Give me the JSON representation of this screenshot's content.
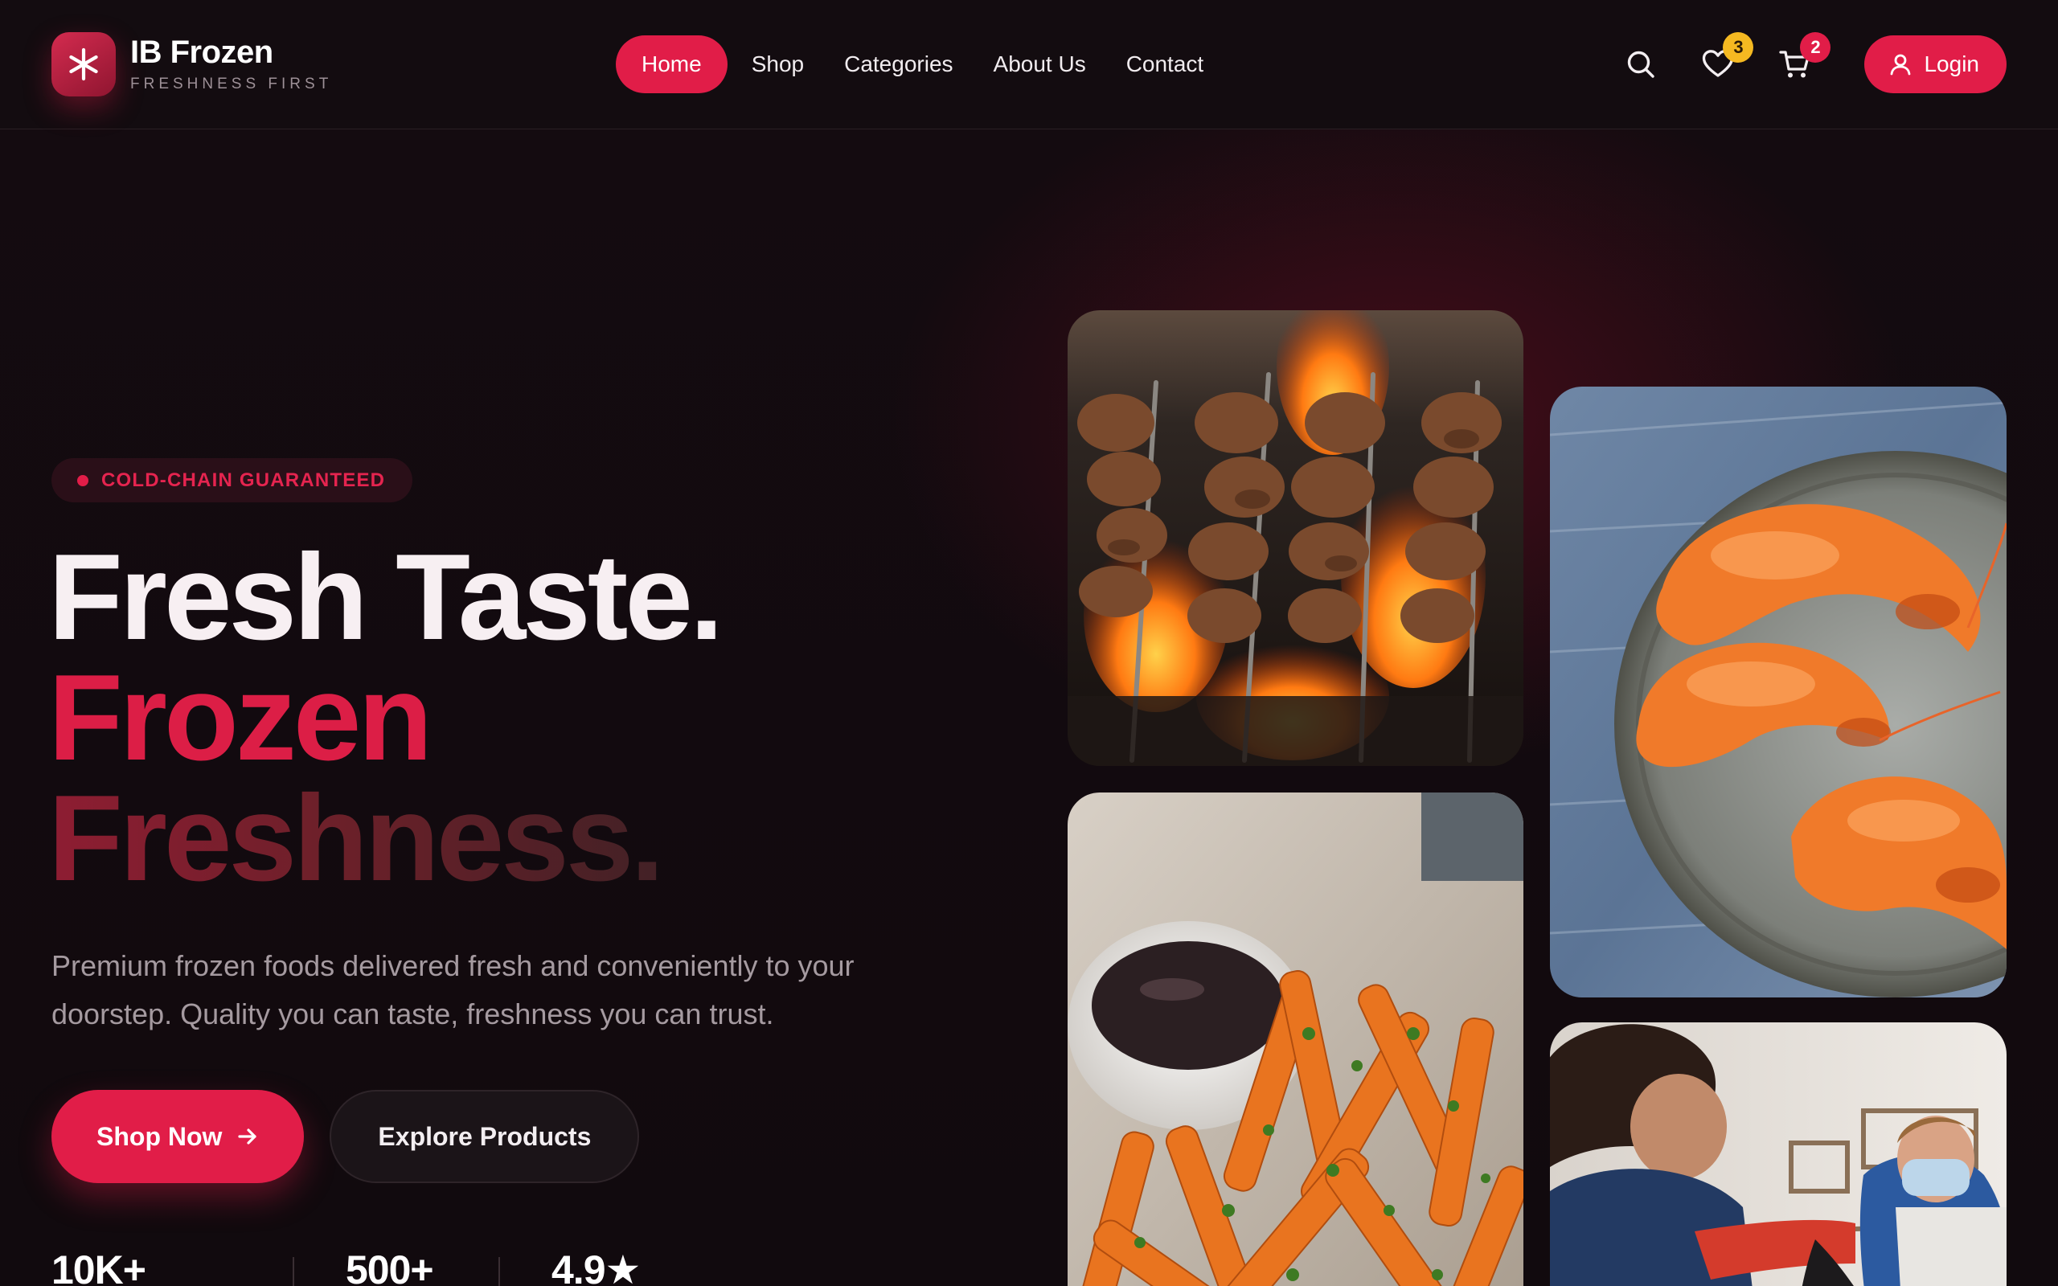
{
  "brand": {
    "name": "IB Frozen",
    "tagline": "FRESHNESS FIRST",
    "logo_icon": "snowflake-icon",
    "accent_color": "#e11d48"
  },
  "nav": {
    "items": [
      {
        "label": "Home",
        "active": true
      },
      {
        "label": "Shop",
        "active": false
      },
      {
        "label": "Categories",
        "active": false
      },
      {
        "label": "About Us",
        "active": false
      },
      {
        "label": "Contact",
        "active": false
      }
    ]
  },
  "actions": {
    "search_icon": "search-icon",
    "wishlist_icon": "heart-icon",
    "wishlist_count": "3",
    "cart_icon": "cart-icon",
    "cart_count": "2",
    "login_label": "Login",
    "login_icon": "user-icon"
  },
  "hero": {
    "badge": "COLD-CHAIN GUARANTEED",
    "headline": [
      "Fresh Taste.",
      "Frozen",
      "Freshness."
    ],
    "description": "Premium frozen foods delivered fresh and conveniently to your doorstep. Quality you can taste, freshness you can trust.",
    "primary_cta": "Shop Now",
    "secondary_cta": "Explore Products",
    "stats": [
      {
        "value": "10K+"
      },
      {
        "value": "500+"
      },
      {
        "value": "4.9★"
      }
    ]
  },
  "gallery": [
    {
      "subject": "grilled-kebab-skewers"
    },
    {
      "subject": "cooked-shrimp-on-plate"
    },
    {
      "subject": "sweet-potato-fries-with-dip"
    },
    {
      "subject": "food-delivery-handoff"
    }
  ]
}
